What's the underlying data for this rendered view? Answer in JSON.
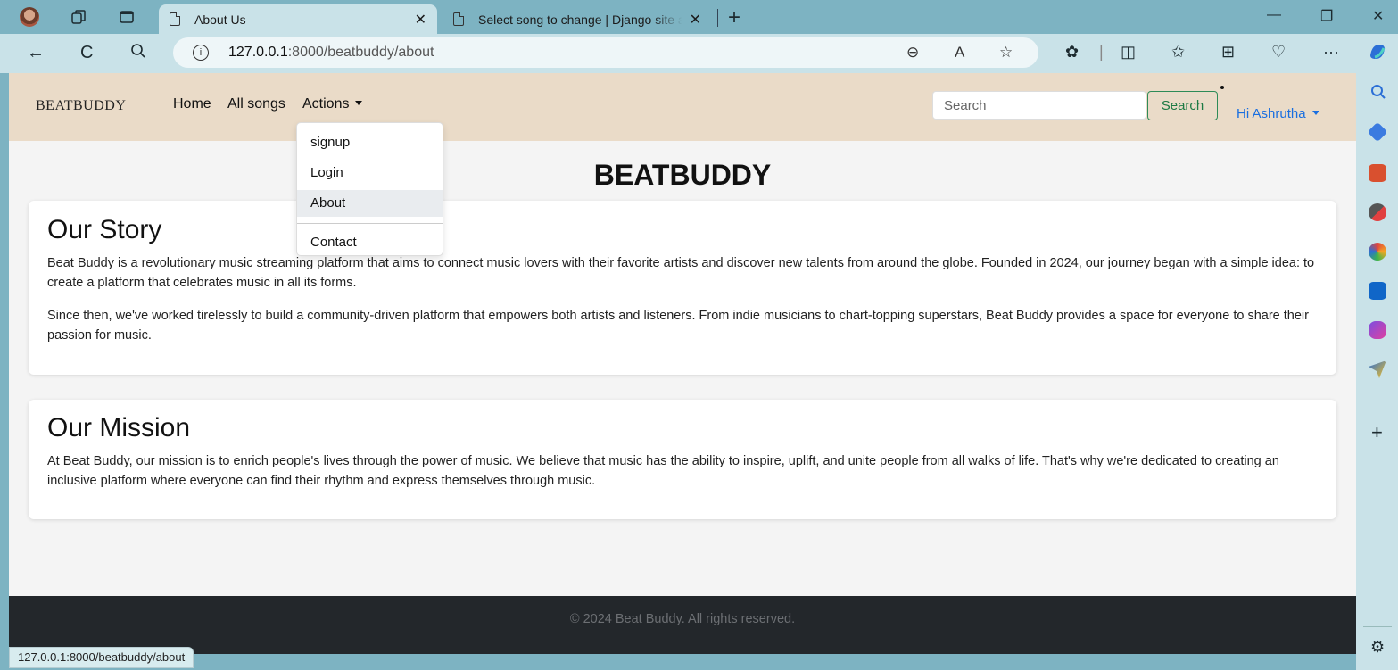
{
  "browser": {
    "tabs": [
      {
        "title": "About Us",
        "active": true
      },
      {
        "title": "Select song to change | Django site admin",
        "active": false
      }
    ],
    "close_glyph": "✕",
    "new_tab_glyph": "+",
    "url_host": "127.0.0.1",
    "url_rest": ":8000/beatbuddy/about",
    "info_glyph": "i",
    "status_url": "127.0.0.1:8000/beatbuddy/about",
    "icons": {
      "back": "←",
      "refresh": "C",
      "search": "⚲",
      "zoom_out": "⊖",
      "read_aloud": "A",
      "favorite": "☆",
      "extensions": "✿",
      "split": "◫",
      "favorites": "✩",
      "collections": "⊞",
      "health": "♡",
      "more": "···",
      "minimize": "—",
      "restore": "❐",
      "close": "✕",
      "sidebar_add": "+",
      "settings": "⚙"
    }
  },
  "site": {
    "brand": "BEATBUDDY",
    "nav": {
      "home": "Home",
      "all_songs": "All songs",
      "actions": "Actions"
    },
    "search": {
      "placeholder": "Search",
      "button": "Search"
    },
    "user_greeting": "Hi Ashrutha",
    "dropdown": [
      {
        "label": "signup",
        "highlighted": false
      },
      {
        "label": "Login",
        "highlighted": false
      },
      {
        "label": "About",
        "highlighted": true
      },
      {
        "label": "Contact",
        "highlighted": false
      }
    ],
    "page_title": "BEATBUDDY",
    "story": {
      "heading": "Our Story",
      "p1": "Beat Buddy is a revolutionary music streaming platform that aims to connect music lovers with their favorite artists and discover new talents from around the globe. Founded in 2024, our journey began with a simple idea: to create a platform that celebrates music in all its forms.",
      "p2": "Since then, we've worked tirelessly to build a community-driven platform that empowers both artists and listeners. From indie musicians to chart-topping superstars, Beat Buddy provides a space for everyone to share their passion for music."
    },
    "mission": {
      "heading": "Our Mission",
      "p1": "At Beat Buddy, our mission is to enrich people's lives through the power of music. We believe that music has the ability to inspire, uplift, and unite people from all walks of life. That's why we're dedicated to creating an inclusive platform where everyone can find their rhythm and express themselves through music."
    },
    "footer": "© 2024 Beat Buddy. All rights reserved."
  },
  "colors": {
    "browser_frame": "#7db3c2",
    "toolbar": "#c9e2e8",
    "navbar": "#eadbc8",
    "search_button_border": "#2e8b57",
    "user_link": "#1a6fe0",
    "footer_bg": "#23272b",
    "footer_text": "#6c6f73"
  }
}
